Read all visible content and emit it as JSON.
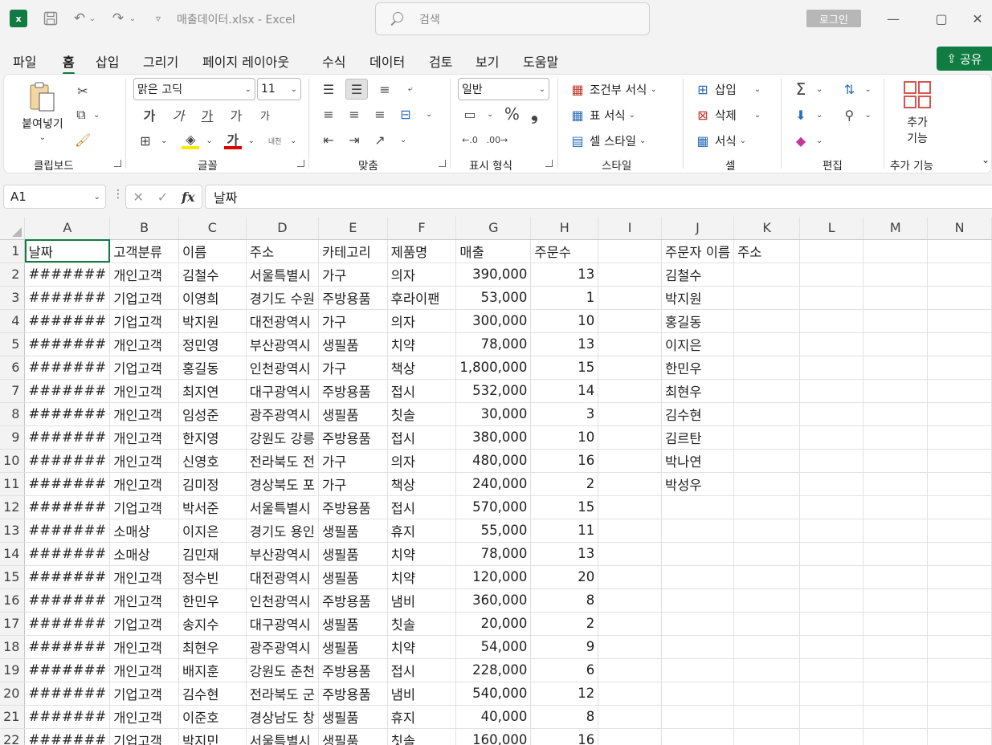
{
  "titlebar": {
    "app_icon_letter": "x",
    "doc_title": "매출데이터.xlsx  -  Excel",
    "search_placeholder": "검색",
    "login_label": "로그인",
    "minimize": "—",
    "maximize": "▢",
    "close": "✕"
  },
  "menu": {
    "tabs": [
      "파일",
      "홈",
      "삽입",
      "그리기",
      "페이지 레이아웃",
      "수식",
      "데이터",
      "검토",
      "보기",
      "도움말"
    ],
    "active": "홈",
    "share_label": "공유"
  },
  "ribbon": {
    "clipboard": {
      "paste_label": "붙여넣기",
      "group_label": "클립보드"
    },
    "font": {
      "font_name": "맑은 고딕",
      "font_size": "11",
      "group_label": "글꼴",
      "bold": "가",
      "italic": "가",
      "underline": "가",
      "grow": "가",
      "shrink": "가",
      "font_color_glyph": "가",
      "phonetic": "내천"
    },
    "alignment": {
      "group_label": "맞춤"
    },
    "number": {
      "format": "일반",
      "group_label": "표시 형식",
      "percent": "%",
      "comma": "❟"
    },
    "styles": {
      "conditional": "조건부 서식",
      "table": "표 서식",
      "cell": "셀 스타일",
      "group_label": "스타일"
    },
    "cells": {
      "insert": "삽입",
      "delete": "삭제",
      "format": "서식",
      "group_label": "셀"
    },
    "editing": {
      "group_label": "편집"
    },
    "addins": {
      "button_label_1": "추가",
      "button_label_2": "기능",
      "group_label": "추가 기능"
    }
  },
  "formula_bar": {
    "name_box": "A1",
    "content": "날짜",
    "fx": "fx"
  },
  "columns": [
    "A",
    "B",
    "C",
    "D",
    "E",
    "F",
    "G",
    "H",
    "I",
    "J",
    "K",
    "L",
    "M",
    "N"
  ],
  "rows": [
    [
      "날짜",
      "고객분류",
      "이름",
      "주소",
      "카테고리",
      "제품명",
      "매출",
      "주문수",
      "",
      "주문자 이름",
      "주소",
      "",
      "",
      ""
    ],
    [
      "#######",
      "개인고객",
      "김철수",
      "서울특별시",
      "가구",
      "의자",
      "390,000",
      "13",
      "",
      "김철수",
      "",
      "",
      "",
      ""
    ],
    [
      "#######",
      "기업고객",
      "이영희",
      "경기도 수원",
      "주방용품",
      "후라이팬",
      "53,000",
      "1",
      "",
      "박지원",
      "",
      "",
      "",
      ""
    ],
    [
      "#######",
      "기업고객",
      "박지원",
      "대전광역시",
      "가구",
      "의자",
      "300,000",
      "10",
      "",
      "홍길동",
      "",
      "",
      "",
      ""
    ],
    [
      "#######",
      "개인고객",
      "정민영",
      "부산광역시",
      "생필품",
      "치약",
      "78,000",
      "13",
      "",
      "이지은",
      "",
      "",
      "",
      ""
    ],
    [
      "#######",
      "기업고객",
      "홍길동",
      "인천광역시",
      "가구",
      "책상",
      "1,800,000",
      "15",
      "",
      "한민우",
      "",
      "",
      "",
      ""
    ],
    [
      "#######",
      "개인고객",
      "최지연",
      "대구광역시",
      "주방용품",
      "접시",
      "532,000",
      "14",
      "",
      "최현우",
      "",
      "",
      "",
      ""
    ],
    [
      "#######",
      "개인고객",
      "임성준",
      "광주광역시",
      "생필품",
      "칫솔",
      "30,000",
      "3",
      "",
      "김수현",
      "",
      "",
      "",
      ""
    ],
    [
      "#######",
      "개인고객",
      "한지영",
      "강원도 강릉",
      "주방용품",
      "접시",
      "380,000",
      "10",
      "",
      "김르탄",
      "",
      "",
      "",
      ""
    ],
    [
      "#######",
      "개인고객",
      "신영호",
      "전라북도 전",
      "가구",
      "의자",
      "480,000",
      "16",
      "",
      "박나연",
      "",
      "",
      "",
      ""
    ],
    [
      "#######",
      "개인고객",
      "김미정",
      "경상북도 포",
      "가구",
      "책상",
      "240,000",
      "2",
      "",
      "박성우",
      "",
      "",
      "",
      ""
    ],
    [
      "#######",
      "기업고객",
      "박서준",
      "서울특별시",
      "주방용품",
      "접시",
      "570,000",
      "15",
      "",
      "",
      "",
      "",
      "",
      ""
    ],
    [
      "#######",
      "소매상",
      "이지은",
      "경기도 용인",
      "생필품",
      "휴지",
      "55,000",
      "11",
      "",
      "",
      "",
      "",
      "",
      ""
    ],
    [
      "#######",
      "소매상",
      "김민재",
      "부산광역시",
      "생필품",
      "치약",
      "78,000",
      "13",
      "",
      "",
      "",
      "",
      "",
      ""
    ],
    [
      "#######",
      "개인고객",
      "정수빈",
      "대전광역시",
      "생필품",
      "치약",
      "120,000",
      "20",
      "",
      "",
      "",
      "",
      "",
      ""
    ],
    [
      "#######",
      "개인고객",
      "한민우",
      "인천광역시",
      "주방용품",
      "냄비",
      "360,000",
      "8",
      "",
      "",
      "",
      "",
      "",
      ""
    ],
    [
      "#######",
      "기업고객",
      "송지수",
      "대구광역시",
      "생필품",
      "칫솔",
      "20,000",
      "2",
      "",
      "",
      "",
      "",
      "",
      ""
    ],
    [
      "#######",
      "개인고객",
      "최현우",
      "광주광역시",
      "생필품",
      "치약",
      "54,000",
      "9",
      "",
      "",
      "",
      "",
      "",
      ""
    ],
    [
      "#######",
      "개인고객",
      "배지훈",
      "강원도 춘천",
      "주방용품",
      "접시",
      "228,000",
      "6",
      "",
      "",
      "",
      "",
      "",
      ""
    ],
    [
      "#######",
      "기업고객",
      "김수현",
      "전라북도 군",
      "주방용품",
      "냄비",
      "540,000",
      "12",
      "",
      "",
      "",
      "",
      "",
      ""
    ],
    [
      "#######",
      "개인고객",
      "이준호",
      "경상남도 창",
      "생필품",
      "휴지",
      "40,000",
      "8",
      "",
      "",
      "",
      "",
      "",
      ""
    ],
    [
      "#######",
      "기업고객",
      "박지민",
      "서울특별시",
      "생필품",
      "칫솔",
      "160,000",
      "16",
      "",
      "",
      "",
      "",
      "",
      ""
    ]
  ],
  "numeric_columns": [
    6,
    7
  ]
}
